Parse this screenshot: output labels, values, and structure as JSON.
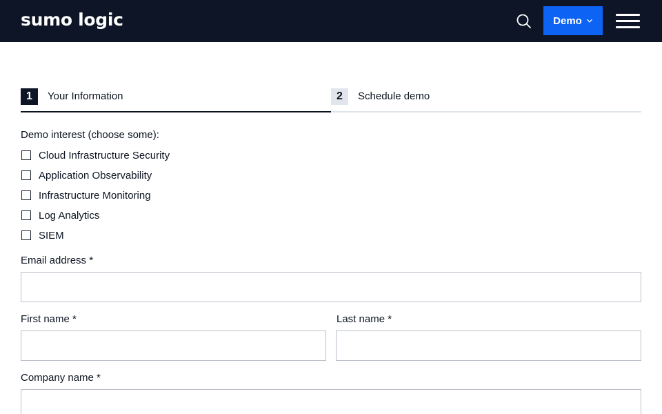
{
  "header": {
    "logo_text": "sumo logic",
    "search_icon": "search-icon",
    "demo_label": "Demo",
    "demo_icon": "chevron-down-icon",
    "menu_icon": "hamburger-menu-icon",
    "colors": {
      "bar": "#0d1526",
      "demo_button": "#0d63f3"
    }
  },
  "steps": [
    {
      "number": "1",
      "label": "Your Information",
      "active": true
    },
    {
      "number": "2",
      "label": "Schedule demo",
      "active": false
    }
  ],
  "form": {
    "interest_label": "Demo interest (choose some):",
    "interests": [
      "Cloud Infrastructure Security",
      "Application Observability",
      "Infrastructure Monitoring",
      "Log Analytics",
      "SIEM"
    ],
    "email_label": "Email address *",
    "email_value": "",
    "first_name_label": "First name *",
    "first_name_value": "",
    "last_name_label": "Last name *",
    "last_name_value": "",
    "company_label": "Company name *",
    "company_value": ""
  }
}
